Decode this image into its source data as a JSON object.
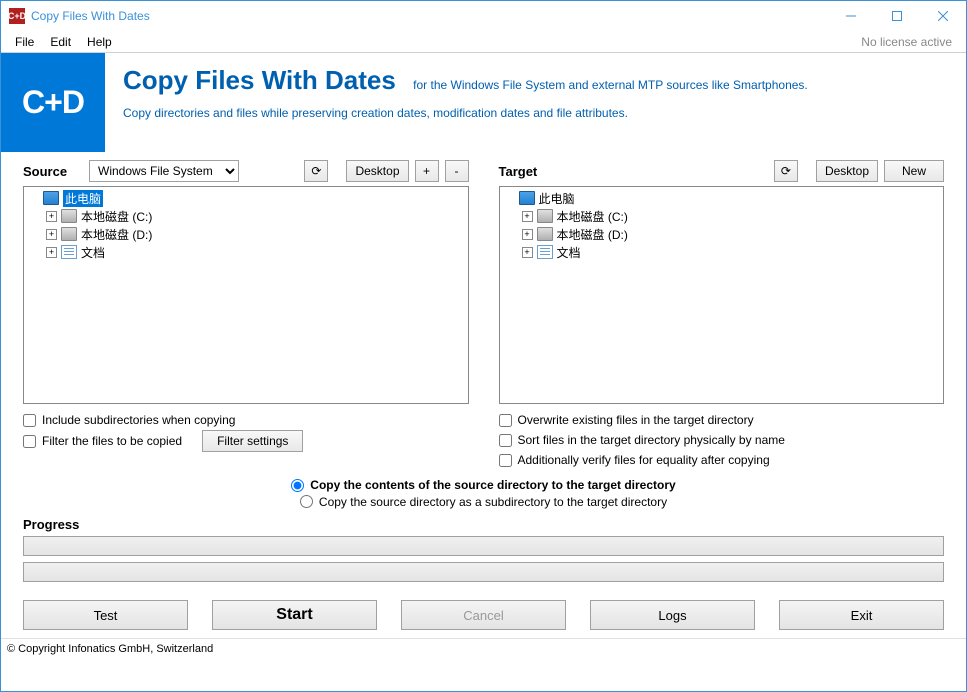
{
  "window": {
    "title": "Copy Files With Dates",
    "icon_label": "C+D"
  },
  "menubar": {
    "file": "File",
    "edit": "Edit",
    "help": "Help",
    "license": "No license active"
  },
  "header": {
    "logo": "C+D",
    "big_title": "Copy Files With Dates",
    "subtitle": "for the Windows File System and external MTP sources like Smartphones.",
    "desc": "Copy directories and files while preserving creation dates, modification dates and file attributes."
  },
  "source": {
    "label": "Source",
    "fs_select": "Windows File System",
    "refresh": "⟳",
    "desktop": "Desktop",
    "plus": "+",
    "minus": "-",
    "opt_subdirs": "Include subdirectories when copying",
    "opt_filter": "Filter the files to be copied",
    "filter_btn": "Filter settings"
  },
  "target": {
    "label": "Target",
    "refresh": "⟳",
    "desktop": "Desktop",
    "new": "New",
    "opt_overwrite": "Overwrite existing files in the target directory",
    "opt_sort": "Sort files in the target directory physically by name",
    "opt_verify": "Additionally verify files for equality after copying"
  },
  "tree": {
    "root": "此电脑",
    "drive_c": "本地磁盘 (C:)",
    "drive_d": "本地磁盘 (D:)",
    "docs": "文档"
  },
  "radios": {
    "r1": "Copy the contents of the source directory to the target directory",
    "r2": "Copy the source directory as a subdirectory to the target directory"
  },
  "progress": {
    "label": "Progress"
  },
  "buttons": {
    "test": "Test",
    "start": "Start",
    "cancel": "Cancel",
    "logs": "Logs",
    "exit": "Exit"
  },
  "footer": {
    "copyright": "© Copyright Infonatics GmbH, Switzerland"
  }
}
